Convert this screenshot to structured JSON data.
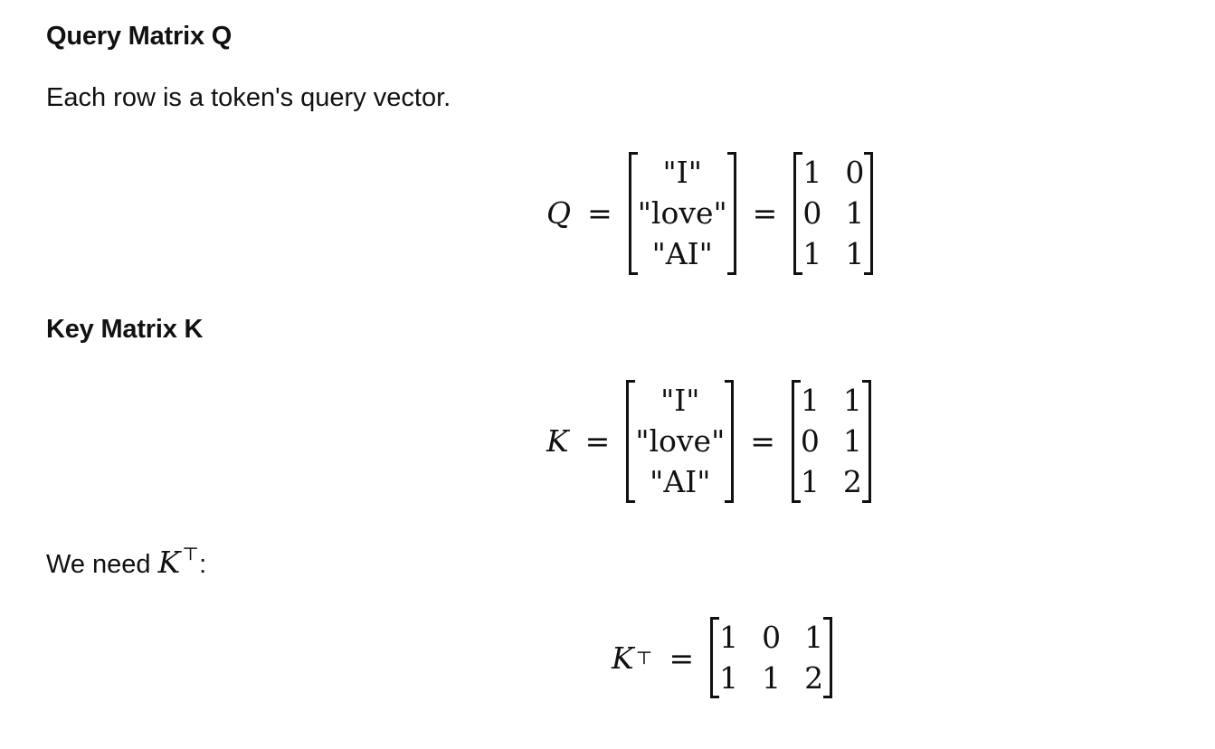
{
  "sections": {
    "query": {
      "heading": "Query Matrix Q",
      "description": "Each row is a token's query vector.",
      "symbol": "Q",
      "tokens": [
        "\"I\"",
        "\"love\"",
        "\"AI\""
      ],
      "rows": [
        [
          "1",
          "0"
        ],
        [
          "0",
          "1"
        ],
        [
          "1",
          "1"
        ]
      ]
    },
    "key": {
      "heading": "Key Matrix K",
      "symbol": "K",
      "tokens": [
        "\"I\"",
        "\"love\"",
        "\"AI\""
      ],
      "rows": [
        [
          "1",
          "1"
        ],
        [
          "0",
          "1"
        ],
        [
          "1",
          "2"
        ]
      ]
    },
    "transpose": {
      "lead_text": "We need",
      "symbol": "K",
      "superscript": "⊤",
      "colon": ":",
      "rows": [
        [
          "1",
          "0",
          "1"
        ],
        [
          "1",
          "1",
          "2"
        ]
      ]
    }
  },
  "symbols": {
    "equals": "="
  }
}
